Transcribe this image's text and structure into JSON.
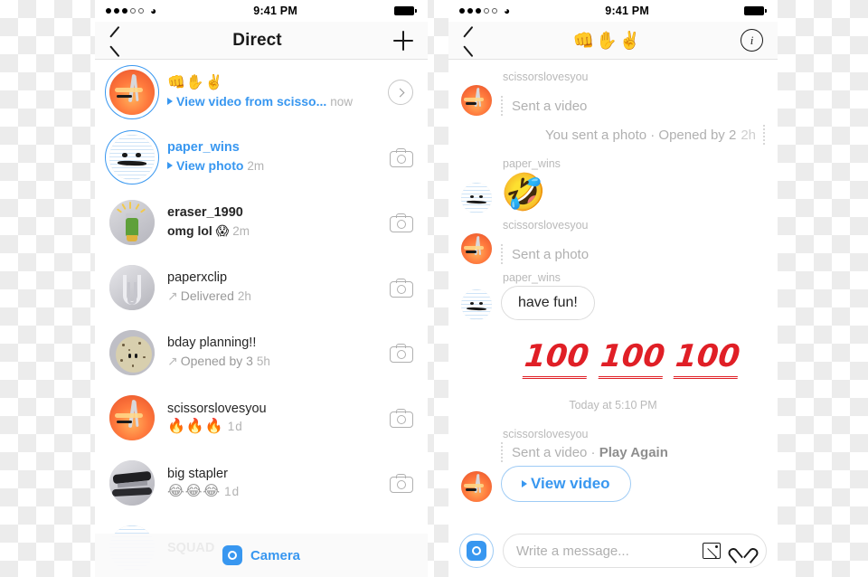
{
  "left": {
    "status": {
      "time": "9:41 PM",
      "wifi": "wifi-icon",
      "battery": "battery-full"
    },
    "nav": {
      "back": "chevron-left-icon",
      "title": "Direct",
      "new": "plus-icon"
    },
    "threads": [
      {
        "name": "👊✋✌️",
        "name_style": "emoji",
        "preview": "View video from scisso...",
        "preview_style": "blue-play",
        "time": "now",
        "ring": true,
        "right_icon": "chevron-right-circle-icon",
        "avatar": "scissors"
      },
      {
        "name": "paper_wins",
        "name_style": "blue",
        "preview": "View photo",
        "preview_style": "blue-play",
        "time": "2m",
        "ring": true,
        "right_icon": "camera-icon",
        "avatar": "paper"
      },
      {
        "name": "eraser_1990",
        "name_style": "bold",
        "preview": "omg lol 😱",
        "preview_style": "dark",
        "time": "2m",
        "ring": false,
        "right_icon": "camera-icon",
        "avatar": "eraser"
      },
      {
        "name": "paperxclip",
        "name_style": "normal",
        "preview": "Delivered",
        "preview_style": "arrow-grey",
        "time": "2h",
        "ring": false,
        "right_icon": "camera-icon",
        "avatar": "clip"
      },
      {
        "name": "bday planning!!",
        "name_style": "normal",
        "preview": "Opened by 3",
        "preview_style": "arrow-grey",
        "time": "5h",
        "ring": false,
        "right_icon": "camera-icon",
        "avatar": "cookie"
      },
      {
        "name": "scissorslovesyou",
        "name_style": "normal",
        "preview": "🔥🔥🔥",
        "preview_style": "emoji",
        "time": "1d",
        "ring": false,
        "right_icon": "camera-icon",
        "avatar": "scissors"
      },
      {
        "name": "big stapler",
        "name_style": "normal",
        "preview": "😂😂😂",
        "preview_style": "emoji",
        "time": "1d",
        "ring": false,
        "right_icon": "camera-icon",
        "avatar": "stapler"
      }
    ],
    "camera_bar": {
      "label": "Camera",
      "icon": "camera-square-icon"
    }
  },
  "right": {
    "status": {
      "time": "9:41 PM",
      "wifi": "wifi-icon",
      "battery": "battery-full"
    },
    "nav": {
      "back": "chevron-left-icon",
      "title": "👊✋✌️",
      "info": "info-circle-icon"
    },
    "messages": [
      {
        "user": "scissorslovesyou",
        "kind": "dotted-note",
        "text": "Sent a video",
        "side": "left",
        "avatar": "scissors"
      },
      {
        "kind": "outgoing-note",
        "text": "You sent a photo · Opened by 2",
        "time": "2h",
        "side": "right"
      },
      {
        "user": "paper_wins",
        "kind": "emoji",
        "text": "🤣",
        "side": "left",
        "avatar": "paper"
      },
      {
        "user": "scissorslovesyou",
        "kind": "dotted-note",
        "text": "Sent a photo",
        "side": "left",
        "avatar": "scissors"
      },
      {
        "user": "paper_wins",
        "kind": "bubble",
        "text": "have fun!",
        "side": "left",
        "avatar": "paper"
      },
      {
        "kind": "hundreds",
        "text": "100",
        "count": 3,
        "color": "#e01f26",
        "side": "right"
      }
    ],
    "daystamp": "Today at 5:10 PM",
    "last": {
      "user": "scissorslovesyou",
      "note_prefix": "Sent a video · ",
      "note_action": "Play Again",
      "button": "View video",
      "avatar": "scissors"
    },
    "composer": {
      "camera_icon": "camera-circle-icon",
      "placeholder": "Write a message...",
      "photo_icon": "photo-icon",
      "heart_icon": "heart-icon"
    }
  },
  "colors": {
    "accent": "#3897f0",
    "muted": "#b9b9b9",
    "text": "#262626",
    "red": "#e01f26"
  }
}
